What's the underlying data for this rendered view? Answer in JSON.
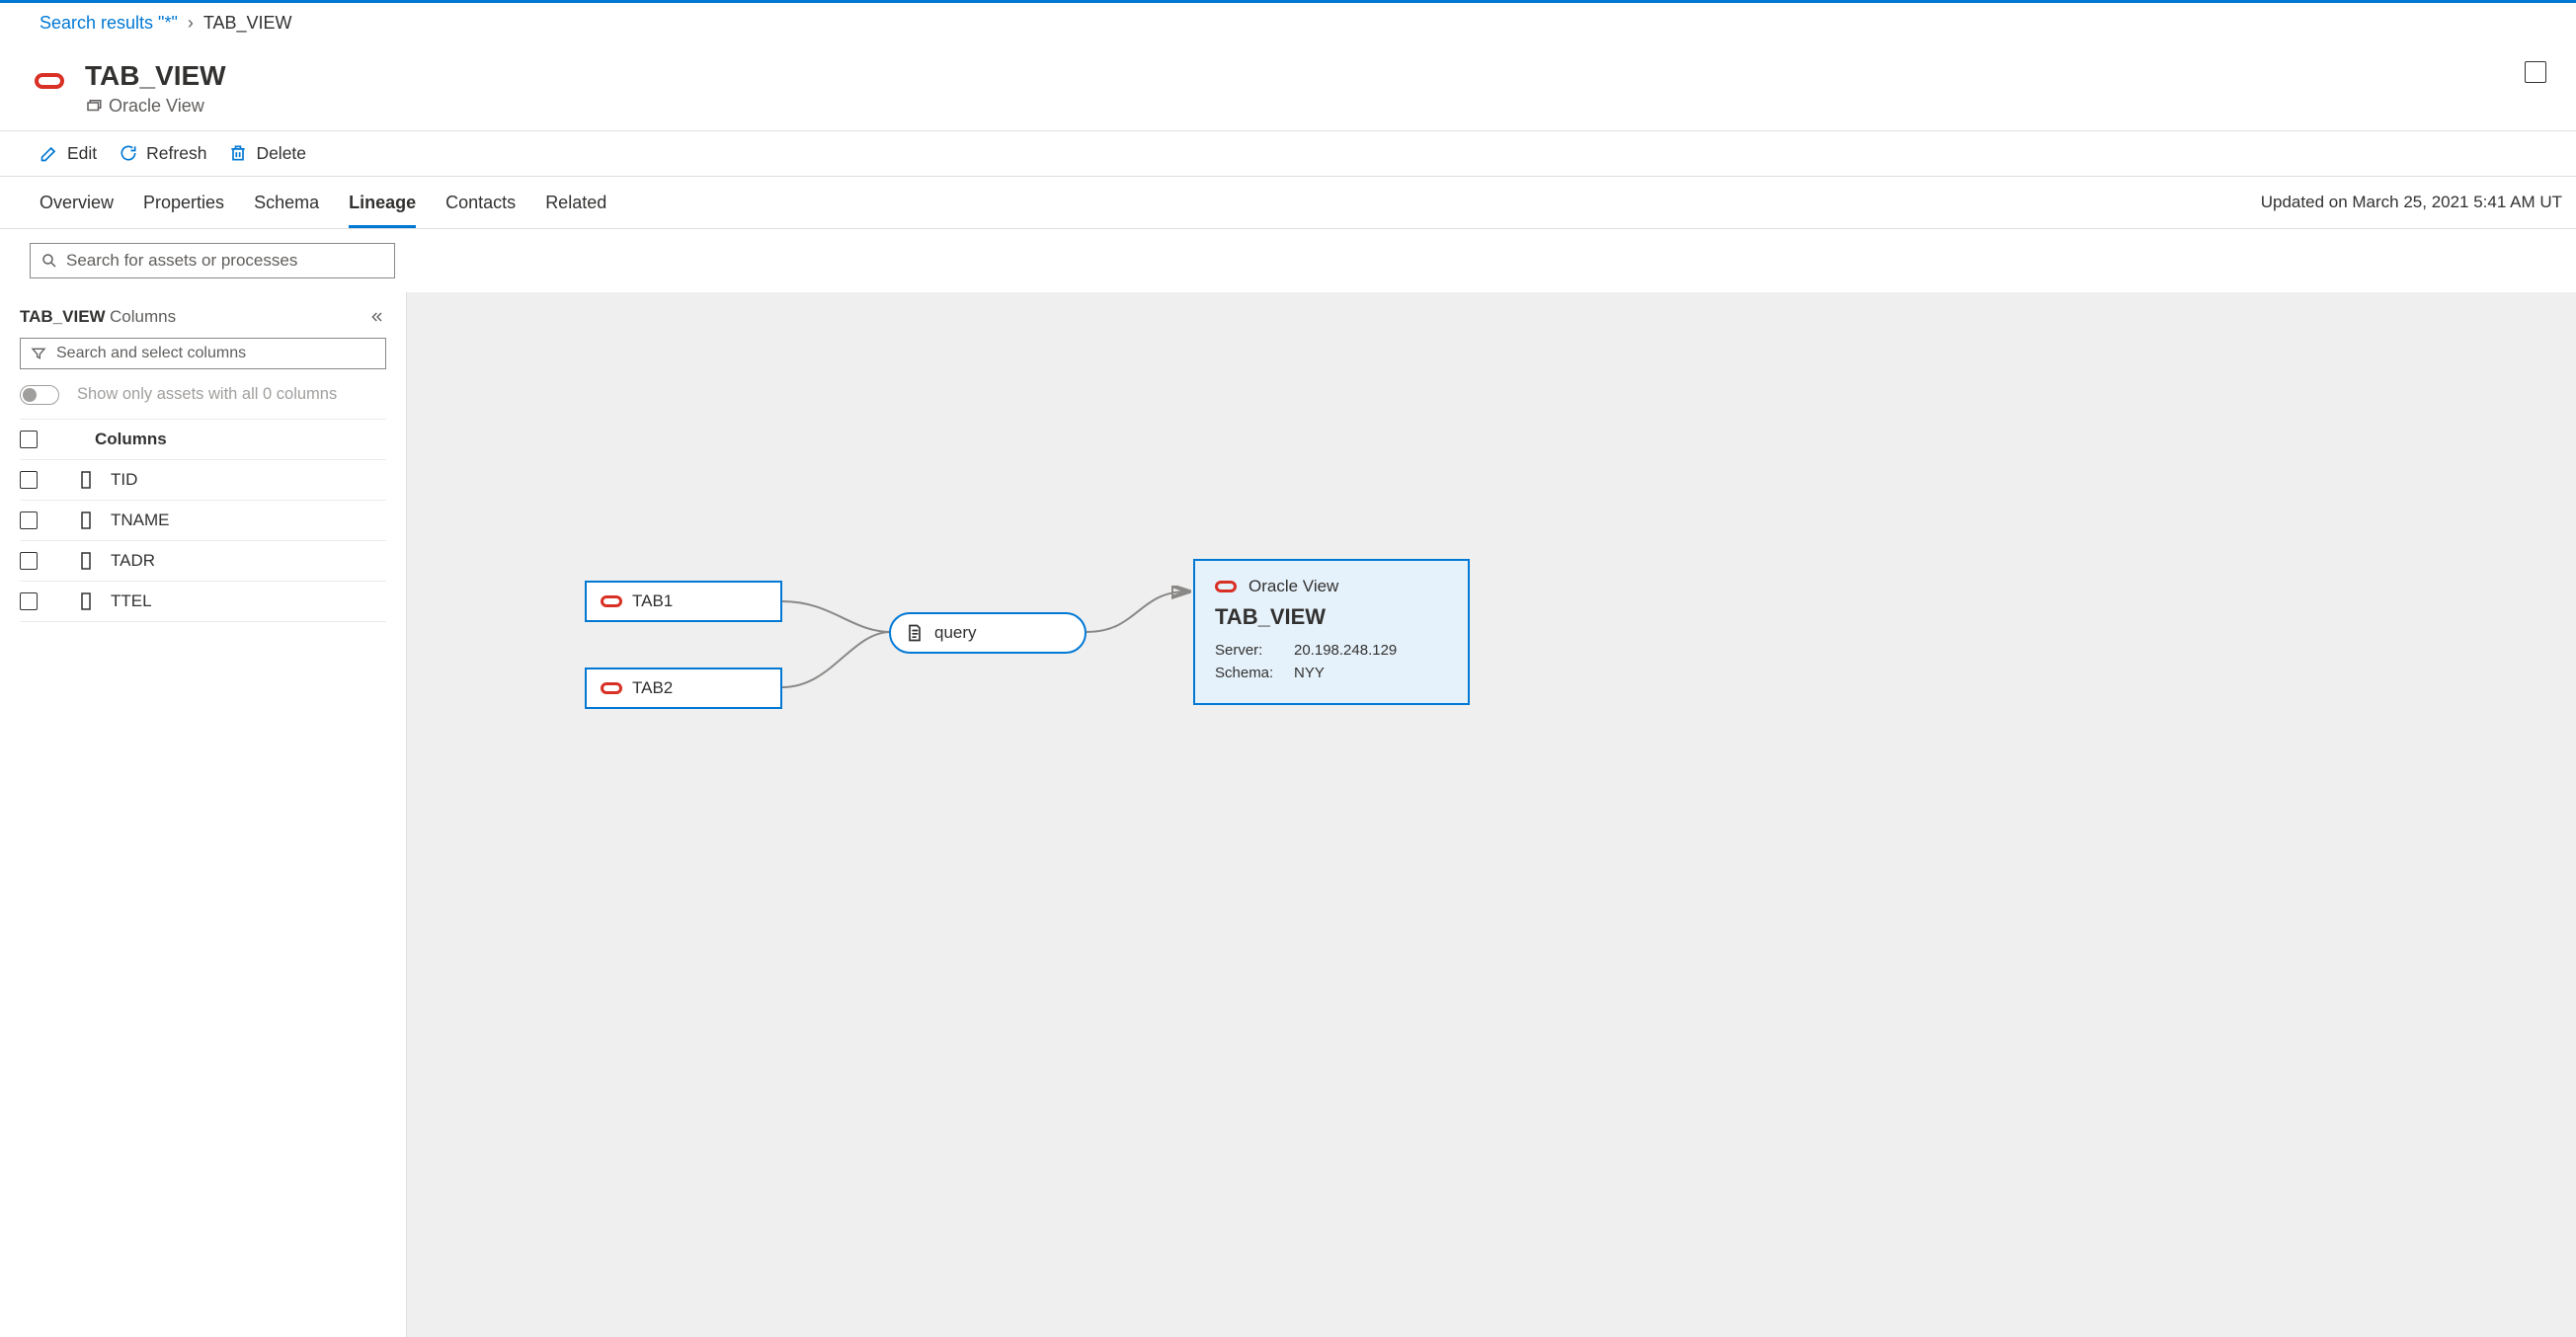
{
  "breadcrumb": {
    "root": "Search results \"*\"",
    "current": "TAB_VIEW"
  },
  "header": {
    "title": "TAB_VIEW",
    "subtitle": "Oracle View"
  },
  "toolbar": {
    "edit": "Edit",
    "refresh": "Refresh",
    "delete": "Delete"
  },
  "tabs": {
    "items": [
      "Overview",
      "Properties",
      "Schema",
      "Lineage",
      "Contacts",
      "Related"
    ],
    "active": 3,
    "updated": "Updated on March 25, 2021 5:41 AM UT"
  },
  "search": {
    "placeholder": "Search for assets or processes"
  },
  "sidebar": {
    "title_entity": "TAB_VIEW",
    "title_suffix": "Columns",
    "filter_placeholder": "Search and select columns",
    "toggle_label": "Show only assets with all 0 columns",
    "columns_header": "Columns",
    "columns": [
      "TID",
      "TNAME",
      "TADR",
      "TTEL"
    ]
  },
  "lineage": {
    "sources": [
      "TAB1",
      "TAB2"
    ],
    "process": "query",
    "target": {
      "type": "Oracle View",
      "name": "TAB_VIEW",
      "props": [
        {
          "k": "Server:",
          "v": "20.198.248.129"
        },
        {
          "k": "Schema:",
          "v": "NYY"
        }
      ]
    }
  }
}
